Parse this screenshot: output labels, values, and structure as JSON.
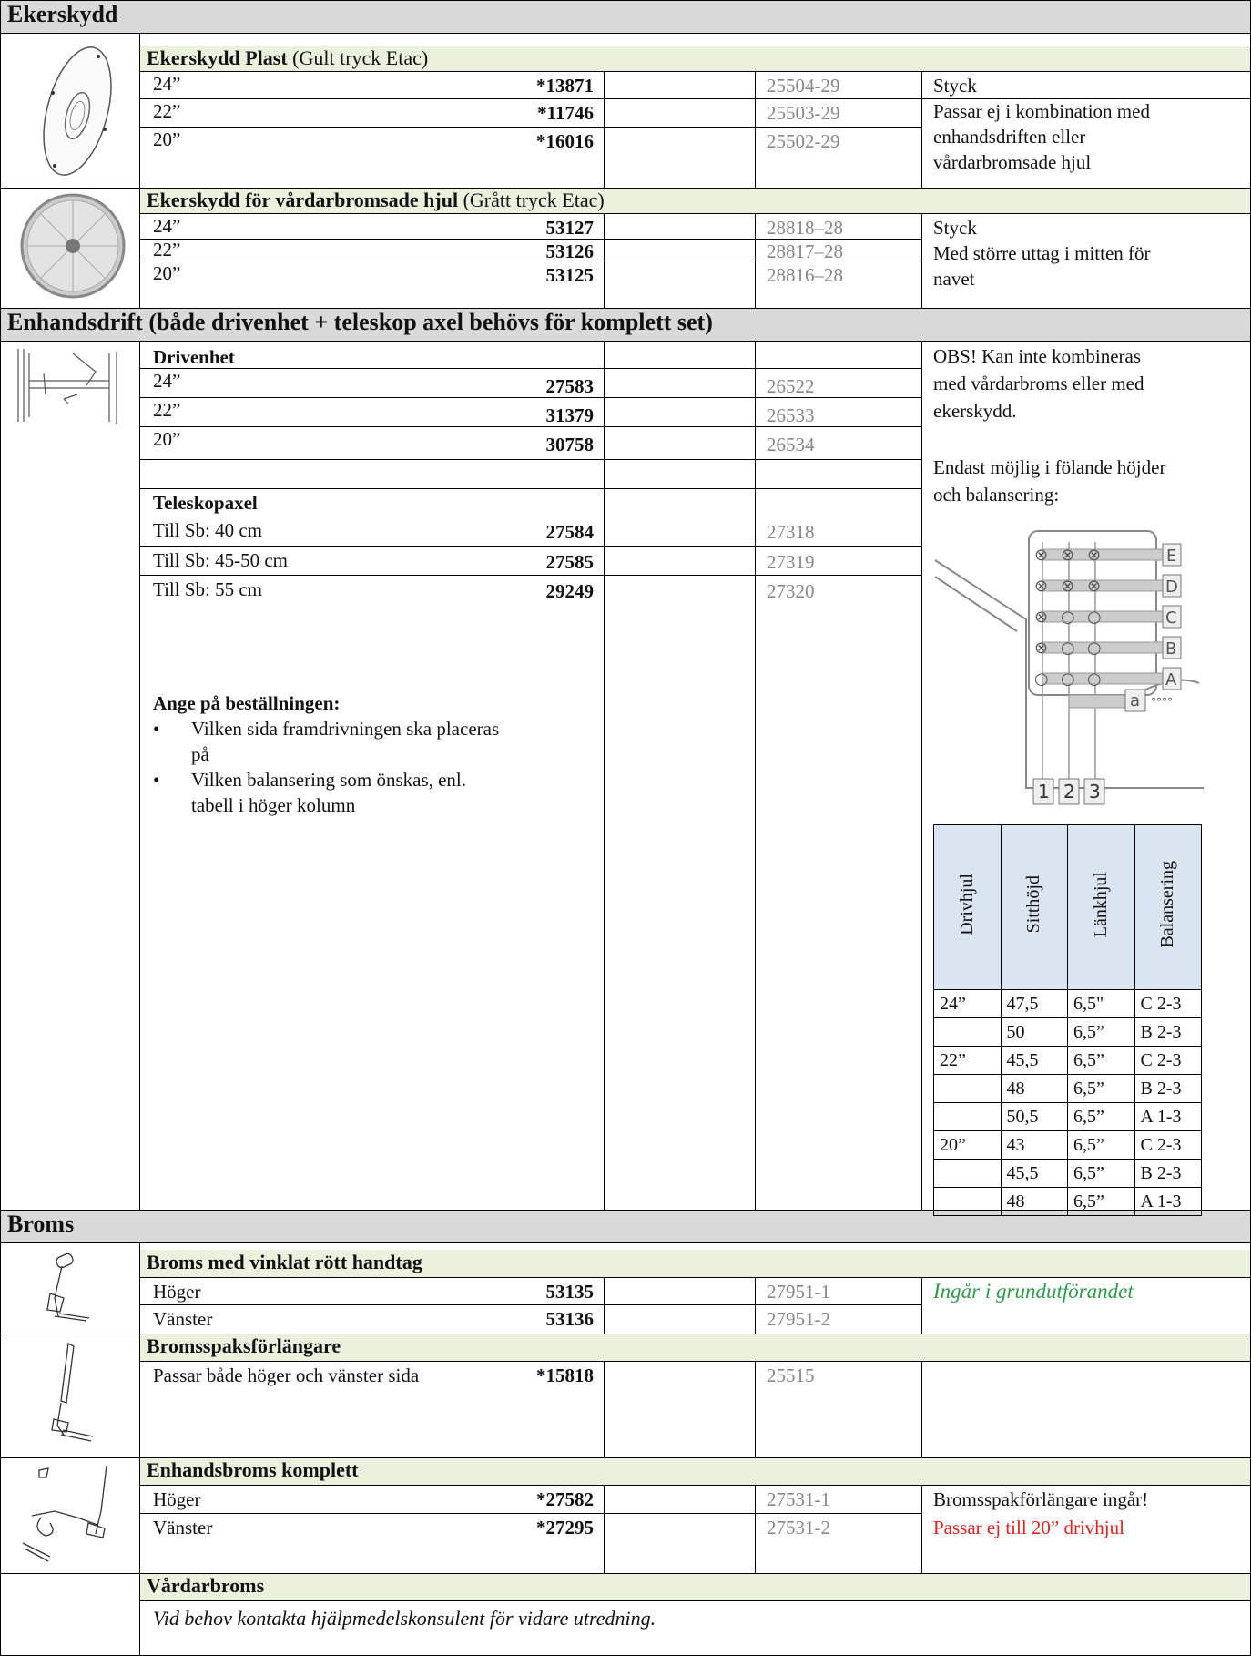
{
  "ekerskydd": {
    "title": "Ekerskydd",
    "plast": {
      "title_bold": "Ekerskydd Plast",
      "title_rest": " (Gult tryck Etac)",
      "rows": [
        {
          "size": "24”",
          "art": "*13871",
          "ref": "25504-29"
        },
        {
          "size": "22”",
          "art": "*11746",
          "ref": "25503-29"
        },
        {
          "size": "20”",
          "art": "*16016",
          "ref": "25502-29"
        }
      ],
      "note": [
        "Styck",
        "Passar ej i kombination med",
        "enhandsdriften eller",
        "vårdarbromsade hjul"
      ]
    },
    "vardar": {
      "title_bold": "Ekerskydd för vårdarbromsade hjul",
      "title_rest": " (Grått tryck Etac)",
      "rows": [
        {
          "size": "24”",
          "art": "53127",
          "ref": "28818–28"
        },
        {
          "size": "22”",
          "art": "53126",
          "ref": "28817–28"
        },
        {
          "size": "20”",
          "art": "53125",
          "ref": "28816–28"
        }
      ],
      "note": [
        "Styck",
        "Med större uttag i mitten för",
        "navet"
      ]
    }
  },
  "enhandsdrift": {
    "title": "Enhandsdrift (både drivenhet + teleskop axel behövs för komplett set)",
    "drivenhet_label": "Drivenhet",
    "drivenhet": [
      {
        "size": "24”",
        "art": "27583",
        "ref": "26522"
      },
      {
        "size": "22”",
        "art": "31379",
        "ref": "26533"
      },
      {
        "size": "20”",
        "art": "30758",
        "ref": "26534"
      }
    ],
    "teleskop_label": "Teleskopaxel",
    "teleskop": [
      {
        "size": "Till Sb: 40 cm",
        "art": "27584",
        "ref": "27318"
      },
      {
        "size": "Till Sb: 45-50 cm",
        "art": "27585",
        "ref": "27319"
      },
      {
        "size": "Till Sb: 55 cm",
        "art": "29249",
        "ref": "27320"
      }
    ],
    "ange_label": "Ange på beställningen:",
    "bullets": [
      [
        "Vilken sida framdrivningen ska placeras",
        "på"
      ],
      [
        "Vilken balansering som önskas, enl.",
        "tabell i höger kolumn"
      ]
    ],
    "obs": [
      "OBS! Kan inte kombineras",
      "med vårdarbroms eller med",
      "ekerskydd."
    ],
    "endast": [
      "Endast möjlig i fölande höjder",
      "och balansering:"
    ],
    "diagram_letters": [
      "E",
      "D",
      "C",
      "B",
      "A"
    ],
    "diagram_small": "a",
    "diagram_numbers": [
      "1",
      "2",
      "3"
    ],
    "table_headers": [
      "Drivhjul",
      "Sitthöjd",
      "Länkhjul",
      "Balansering"
    ],
    "table_rows": [
      [
        "24”",
        "47,5",
        "6,5\"",
        "C 2-3"
      ],
      [
        "",
        "50",
        "6,5”",
        "B 2-3"
      ],
      [
        "22”",
        "45,5",
        "6,5”",
        "C 2-3"
      ],
      [
        "",
        "48",
        "6,5”",
        "B 2-3"
      ],
      [
        "",
        "50,5",
        "6,5”",
        "A 1-3"
      ],
      [
        "20”",
        "43",
        "6,5”",
        "C 2-3"
      ],
      [
        "",
        "45,5",
        "6,5”",
        "B 2-3"
      ],
      [
        "",
        "48",
        "6,5”",
        "A 1-3"
      ]
    ]
  },
  "broms": {
    "title": "Broms",
    "vinklat": {
      "title": "Broms med vinklat rött handtag",
      "rows": [
        {
          "size": "Höger",
          "art": "53135",
          "ref": "27951-1"
        },
        {
          "size": "Vänster",
          "art": "53136",
          "ref": "27951-2"
        }
      ],
      "note": "Ingår i grundutförandet"
    },
    "forlangare": {
      "title": "Bromsspaksförlängare",
      "rows": [
        {
          "size": "Passar både höger och vänster sida",
          "art": "*15818",
          "ref": "25515"
        }
      ]
    },
    "enhand": {
      "title": "Enhandsbroms komplett",
      "rows": [
        {
          "size": "Höger",
          "art": "*27582",
          "ref": "27531-1"
        },
        {
          "size": "Vänster",
          "art": "*27295",
          "ref": "27531-2"
        }
      ],
      "note1": "Bromsspakförlängare ingår!",
      "note2": "Passar ej till 20” drivhjul"
    },
    "vardarbroms": {
      "title": "Vårdarbroms",
      "text": "Vid behov kontakta hjälpmedelskonsulent för vidare utredning."
    }
  },
  "colors": {
    "header": "#d9d9d9",
    "subheader": "#eaf1dd",
    "table_header": "#dbe5f1",
    "green": "#2e9b4a",
    "red": "#e0211f"
  }
}
